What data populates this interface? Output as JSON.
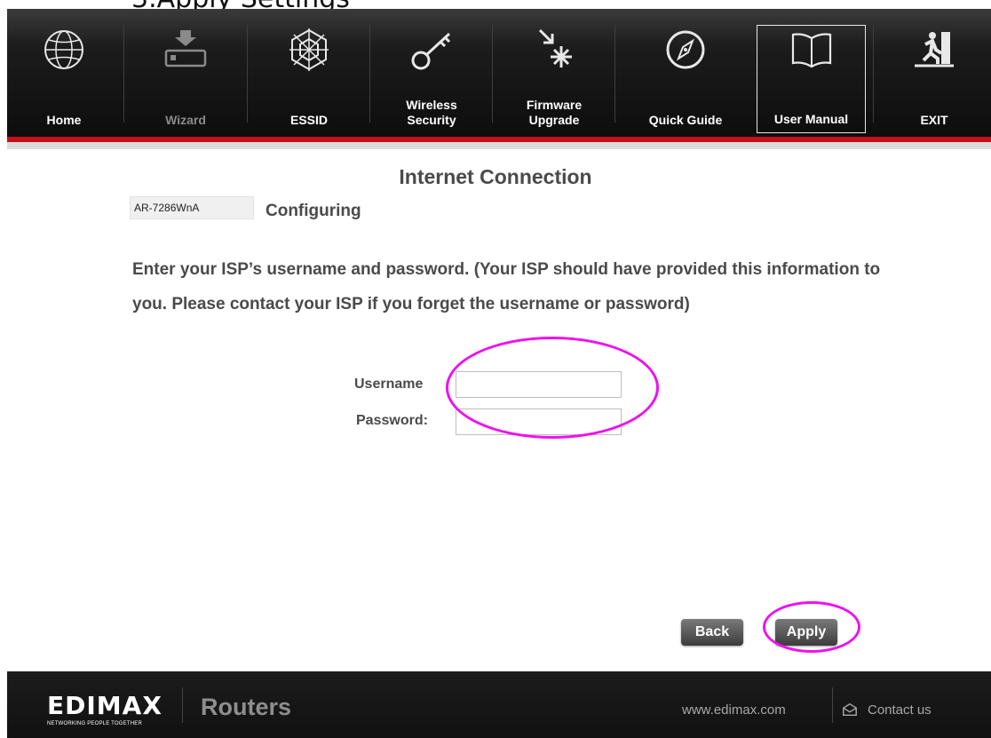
{
  "cut_text": "3.Apply Settings",
  "nav": {
    "items": [
      {
        "label_line1": "Home",
        "label_line2": "",
        "icon": "globe-icon",
        "state": "normal"
      },
      {
        "label_line1": "Wizard",
        "label_line2": "",
        "icon": "router-download-icon",
        "state": "disabled"
      },
      {
        "label_line1": "ESSID",
        "label_line2": "",
        "icon": "web-icon",
        "state": "normal"
      },
      {
        "label_line1": "Wireless",
        "label_line2": "Security",
        "icon": "key-icon",
        "state": "normal"
      },
      {
        "label_line1": "Firmware",
        "label_line2": "Upgrade",
        "icon": "firmware-arrow-icon",
        "state": "normal"
      },
      {
        "label_line1": "Quick Guide",
        "label_line2": "",
        "icon": "compass-icon",
        "state": "normal"
      },
      {
        "label_line1": "User Manual",
        "label_line2": "",
        "icon": "book-icon",
        "state": "selected"
      },
      {
        "label_line1": "EXIT",
        "label_line2": "",
        "icon": "exit-icon",
        "state": "normal"
      }
    ]
  },
  "main": {
    "title": "Internet Connection",
    "model": "AR-7286WnA",
    "status": "Configuring",
    "instructions": "Enter your ISP’s username and password. (Your ISP should have provided this information to you. Please contact your ISP if you forget the username or password)",
    "username_label": "Username",
    "username_value": "",
    "password_label": "Password:",
    "password_value": ""
  },
  "buttons": {
    "back": "Back",
    "apply": "Apply"
  },
  "footer": {
    "logo": "EDIMAX",
    "tagline": "NETWORKING PEOPLE TOGETHER",
    "product": "Routers",
    "website": "www.edimax.com",
    "contact": "Contact us"
  },
  "colors": {
    "accent_red": "#c4101b",
    "annotation": "#ee11ee",
    "topbar": "#151515"
  }
}
